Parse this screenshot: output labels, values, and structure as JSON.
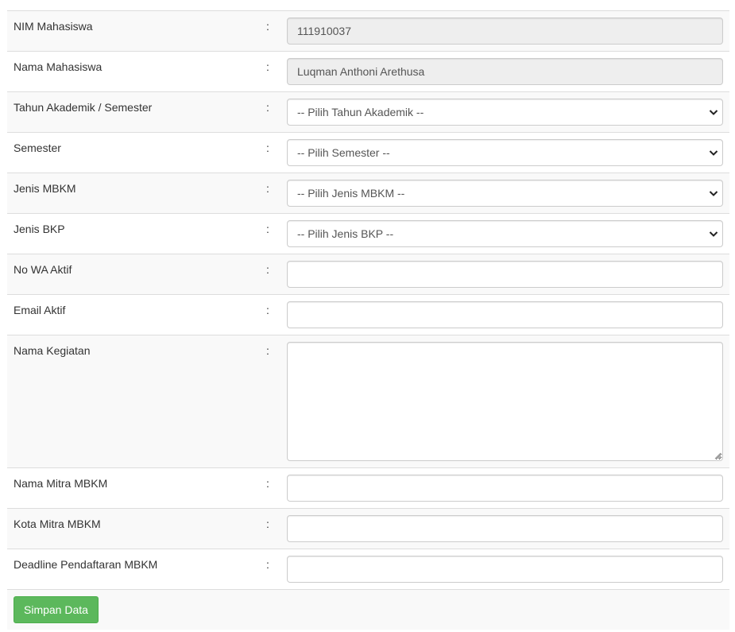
{
  "form": {
    "colon": ":",
    "nim": {
      "label": "NIM Mahasiswa",
      "value": "111910037"
    },
    "nama": {
      "label": "Nama Mahasiswa",
      "value": "Luqman Anthoni Arethusa"
    },
    "tahun_akademik": {
      "label": "Tahun Akademik / Semester",
      "selected": "-- Pilih Tahun Akademik --"
    },
    "semester": {
      "label": "Semester",
      "selected": "-- Pilih Semester --"
    },
    "jenis_mbkm": {
      "label": "Jenis MBKM",
      "selected": "-- Pilih Jenis MBKM --"
    },
    "jenis_bkp": {
      "label": "Jenis BKP",
      "selected": "-- Pilih Jenis BKP --"
    },
    "no_wa": {
      "label": "No WA Aktif",
      "value": ""
    },
    "email": {
      "label": "Email Aktif",
      "value": ""
    },
    "nama_kegiatan": {
      "label": "Nama Kegiatan",
      "value": ""
    },
    "nama_mitra": {
      "label": "Nama Mitra MBKM",
      "value": ""
    },
    "kota_mitra": {
      "label": "Kota Mitra MBKM",
      "value": ""
    },
    "deadline": {
      "label": "Deadline Pendaftaran MBKM",
      "value": ""
    },
    "submit_label": "Simpan Data"
  },
  "icons": {
    "select_arrow": "chevron-down-icon",
    "textarea_grip": "resize-grip-icon"
  },
  "colors": {
    "stripe": "#f9f9f9",
    "readonly_bg": "#eeeeee",
    "border": "#dddddd",
    "button": "#5cb85c"
  }
}
